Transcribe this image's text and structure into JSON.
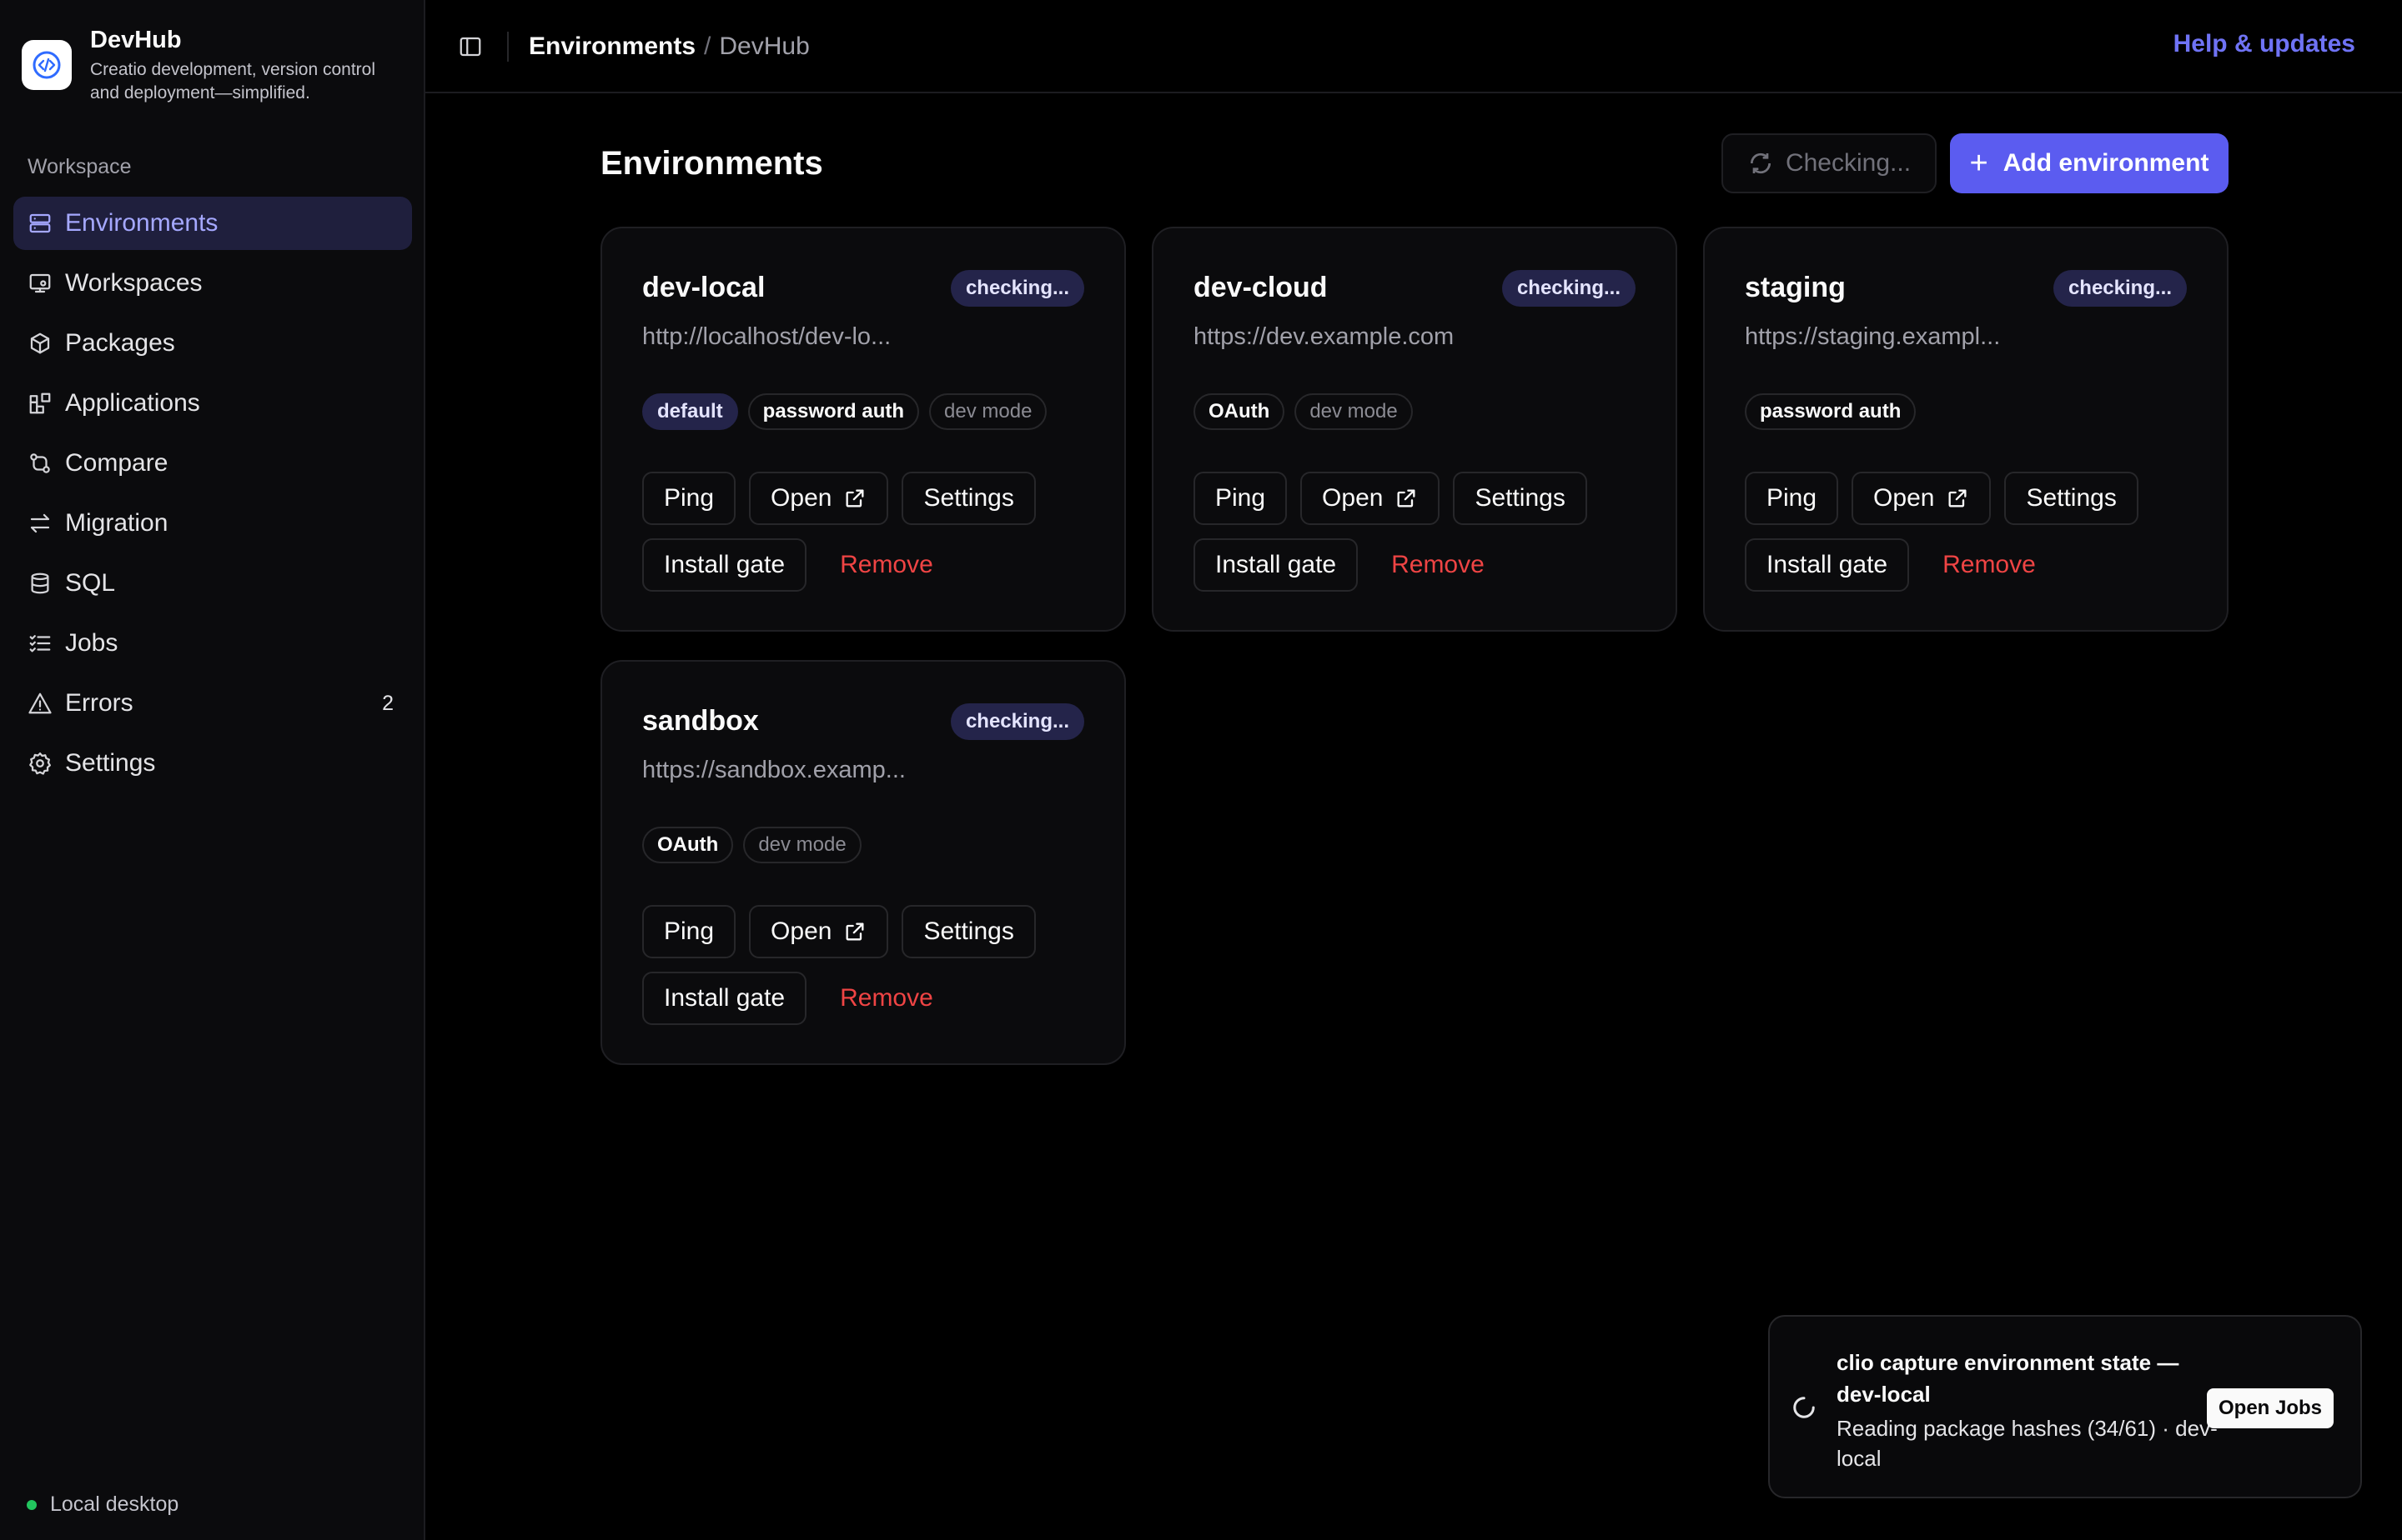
{
  "app": {
    "name": "DevHub",
    "description": "Creatio development, version control and deployment—simplified."
  },
  "sidebar": {
    "section_label": "Workspace",
    "items": [
      {
        "label": "Environments",
        "icon": "server-icon",
        "active": true
      },
      {
        "label": "Workspaces",
        "icon": "workspace-icon"
      },
      {
        "label": "Packages",
        "icon": "package-icon"
      },
      {
        "label": "Applications",
        "icon": "applications-icon"
      },
      {
        "label": "Compare",
        "icon": "compare-icon"
      },
      {
        "label": "Migration",
        "icon": "migration-icon"
      },
      {
        "label": "SQL",
        "icon": "database-icon"
      },
      {
        "label": "Jobs",
        "icon": "jobs-icon"
      },
      {
        "label": "Errors",
        "icon": "warning-icon",
        "badge": "2"
      },
      {
        "label": "Settings",
        "icon": "gear-icon"
      }
    ],
    "footer_status": "Local desktop",
    "footer_status_color": "#22c55e"
  },
  "topbar": {
    "breadcrumb_current": "Environments",
    "breadcrumb_separator": "/",
    "breadcrumb_root": "DevHub",
    "help_link": "Help & updates"
  },
  "main": {
    "title": "Environments",
    "checking_button": "Checking...",
    "add_button": "Add environment",
    "accent_color": "#5b5cf0",
    "environments": [
      {
        "name": "dev-local",
        "status": "checking...",
        "url": "http://localhost/dev-lo...",
        "tags": [
          "default",
          "password auth",
          "dev mode"
        ],
        "actions": {
          "ping": "Ping",
          "open": "Open",
          "settings": "Settings",
          "install_gate": "Install gate",
          "remove": "Remove"
        }
      },
      {
        "name": "dev-cloud",
        "status": "checking...",
        "url": "https://dev.example.com",
        "tags": [
          "OAuth",
          "dev mode"
        ],
        "actions": {
          "ping": "Ping",
          "open": "Open",
          "settings": "Settings",
          "install_gate": "Install gate",
          "remove": "Remove"
        }
      },
      {
        "name": "staging",
        "status": "checking...",
        "url": "https://staging.exampl...",
        "tags": [
          "password auth"
        ],
        "actions": {
          "ping": "Ping",
          "open": "Open",
          "settings": "Settings",
          "install_gate": "Install gate",
          "remove": "Remove"
        }
      },
      {
        "name": "sandbox",
        "status": "checking...",
        "url": "https://sandbox.examp...",
        "tags": [
          "OAuth",
          "dev mode"
        ],
        "actions": {
          "ping": "Ping",
          "open": "Open",
          "settings": "Settings",
          "install_gate": "Install gate",
          "remove": "Remove"
        }
      }
    ]
  },
  "toast": {
    "title": "clio capture environment state — dev-local",
    "subtitle": "Reading package hashes (34/61) · dev-local",
    "button": "Open Jobs"
  }
}
